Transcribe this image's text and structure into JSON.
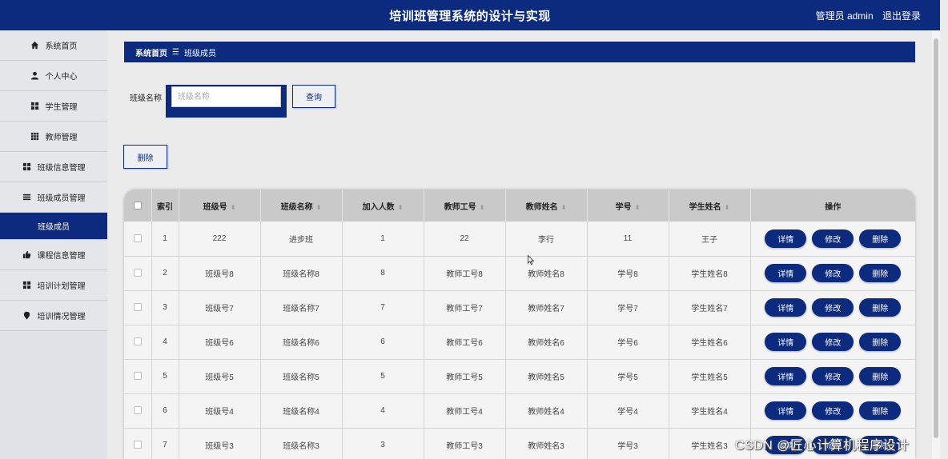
{
  "header": {
    "title": "培训班管理系统的设计与实现",
    "user": "管理员 admin",
    "logout": "退出登录"
  },
  "sidebar": {
    "items": [
      {
        "label": "系统首页",
        "icon": "home-icon"
      },
      {
        "label": "个人中心",
        "icon": "person-icon"
      },
      {
        "label": "学生管理",
        "icon": "grid-icon"
      },
      {
        "label": "教师管理",
        "icon": "grid9-icon"
      },
      {
        "label": "班级信息管理",
        "icon": "grid-icon"
      },
      {
        "label": "班级成员管理",
        "icon": "list-icon"
      },
      {
        "label": "班级成员",
        "icon": "",
        "active": true
      },
      {
        "label": "课程信息管理",
        "icon": "thumbs-up-icon"
      },
      {
        "label": "培训计划管理",
        "icon": "grid-icon"
      },
      {
        "label": "培训情况管理",
        "icon": "map-pin-icon"
      }
    ]
  },
  "breadcrumb": {
    "home": "系统首页",
    "sep": "☰",
    "current": "班级成员"
  },
  "search": {
    "label": "班级名称",
    "placeholder": "班级名称",
    "query_button": "查询"
  },
  "toolbar": {
    "delete_button": "删除"
  },
  "table": {
    "columns": [
      "",
      "索引",
      "班级号",
      "班级名称",
      "加入人数",
      "教师工号",
      "教师姓名",
      "学号",
      "学生姓名",
      "操作"
    ],
    "sortable": [
      false,
      false,
      true,
      true,
      true,
      true,
      true,
      true,
      true,
      false
    ],
    "sort_glyph": "⬍",
    "actions": [
      "详情",
      "修改",
      "删除"
    ],
    "rows": [
      [
        "1",
        "222",
        "进步班",
        "1",
        "22",
        "李行",
        "11",
        "王子"
      ],
      [
        "2",
        "班级号8",
        "班级名称8",
        "8",
        "教师工号8",
        "教师姓名8",
        "学号8",
        "学生姓名8"
      ],
      [
        "3",
        "班级号7",
        "班级名称7",
        "7",
        "教师工号7",
        "教师姓名7",
        "学号7",
        "学生姓名7"
      ],
      [
        "4",
        "班级号6",
        "班级名称6",
        "6",
        "教师工号6",
        "教师姓名6",
        "学号6",
        "学生姓名6"
      ],
      [
        "5",
        "班级号5",
        "班级名称5",
        "5",
        "教师工号5",
        "教师姓名5",
        "学号5",
        "学生姓名5"
      ],
      [
        "6",
        "班级号4",
        "班级名称4",
        "4",
        "教师工号4",
        "教师姓名4",
        "学号4",
        "学生姓名4"
      ],
      [
        "7",
        "班级号3",
        "班级名称3",
        "3",
        "教师工号3",
        "教师姓名3",
        "学号3",
        "学生姓名3"
      ]
    ]
  },
  "watermark": "CSDN @匠心计算机程序设计",
  "colors": {
    "primary": "#0c2a7e",
    "header_row": "#c9c9c9",
    "row_bg": "#f4f4f4"
  }
}
